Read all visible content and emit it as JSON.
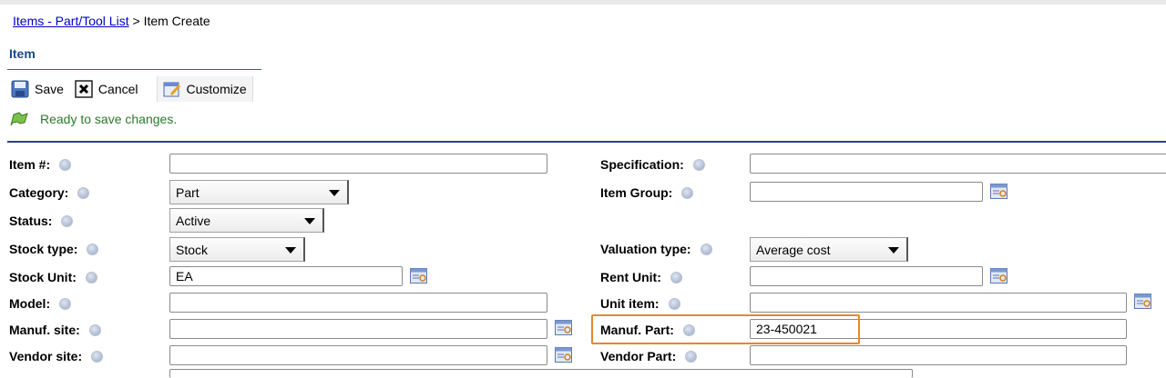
{
  "breadcrumb": {
    "link": "Items - Part/Tool List",
    "separator": ">",
    "current": "Item Create"
  },
  "section": {
    "title": "Item"
  },
  "toolbar": {
    "save": "Save",
    "cancel": "Cancel",
    "customize": "Customize"
  },
  "status": {
    "message": "Ready to save changes."
  },
  "left_fields": {
    "item_no": {
      "label": "Item #:",
      "value": ""
    },
    "category": {
      "label": "Category:",
      "value": "Part"
    },
    "status": {
      "label": "Status:",
      "value": "Active"
    },
    "stock_type": {
      "label": "Stock type:",
      "value": "Stock"
    },
    "stock_unit": {
      "label": "Stock Unit:",
      "value": "EA"
    },
    "model": {
      "label": "Model:",
      "value": ""
    },
    "manuf_site": {
      "label": "Manuf. site:",
      "value": ""
    },
    "vendor_site": {
      "label": "Vendor site:",
      "value": ""
    }
  },
  "right_fields": {
    "specification": {
      "label": "Specification:",
      "value": ""
    },
    "item_group": {
      "label": "Item Group:",
      "value": ""
    },
    "valuation_type": {
      "label": "Valuation type:",
      "value": "Average cost"
    },
    "rent_unit": {
      "label": "Rent Unit:",
      "value": ""
    },
    "unit_item": {
      "label": "Unit item:",
      "value": ""
    },
    "manuf_part": {
      "label": "Manuf. Part:",
      "value": "23-450021"
    },
    "vendor_part": {
      "label": "Vendor Part:",
      "value": ""
    }
  },
  "colors": {
    "link": "#0000cc",
    "title": "#1a4a8a",
    "status": "#2a7a2a",
    "highlight": "#e8862a",
    "rule": "#2a3e8a"
  }
}
